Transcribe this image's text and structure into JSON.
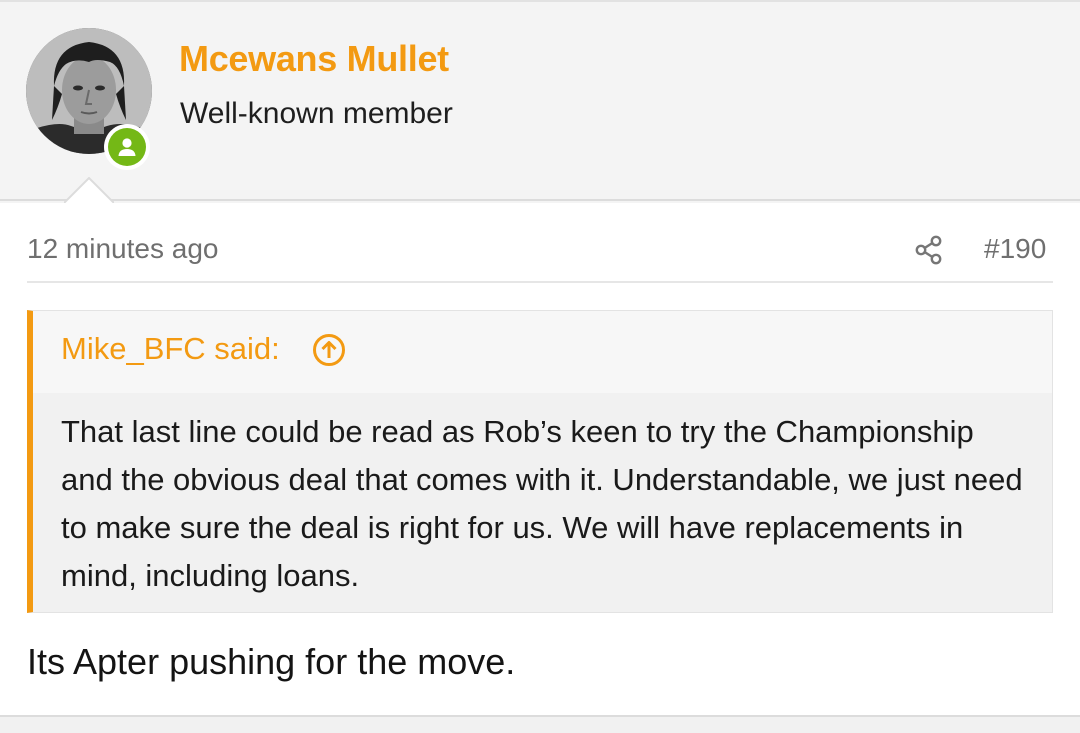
{
  "user": {
    "name": "Mcewans Mullet",
    "title": "Well-known member",
    "online": true
  },
  "post": {
    "timestamp": "12 minutes ago",
    "number": "#190",
    "message": "Its Apter pushing for the move."
  },
  "quote": {
    "author": "Mike_BFC said:",
    "text": "That last line could be read as Rob’s keen to try the Championship and the obvious deal that comes with it. Understandable, we just need to make sure the deal is right for us. We will have replacements in mind, including loans."
  },
  "icons": {
    "share": "share-icon",
    "jump": "arrow-up-circle-icon",
    "online": "user-icon"
  },
  "colors": {
    "accent": "#f39a12",
    "online": "#74b816",
    "muted_text": "#6f6f6f"
  }
}
